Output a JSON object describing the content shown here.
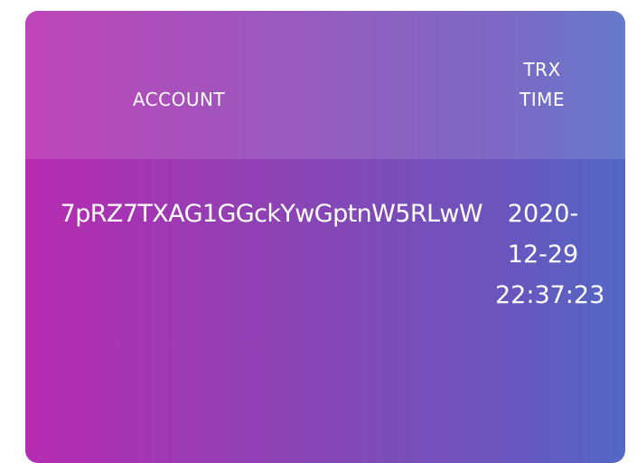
{
  "table": {
    "headers": {
      "account": "ACCOUNT",
      "time": "TRX\nTIME"
    },
    "rows": [
      {
        "account": "7pRZ7TXAG1GGckYwGptnW5RLwW",
        "time": "2020-\n12-29\n22:37:23"
      }
    ]
  },
  "colors": {
    "gradient_left": "#b62bb0",
    "gradient_mid": "#8a44b4",
    "gradient_right": "#5268c4",
    "text": "#ffffff"
  }
}
